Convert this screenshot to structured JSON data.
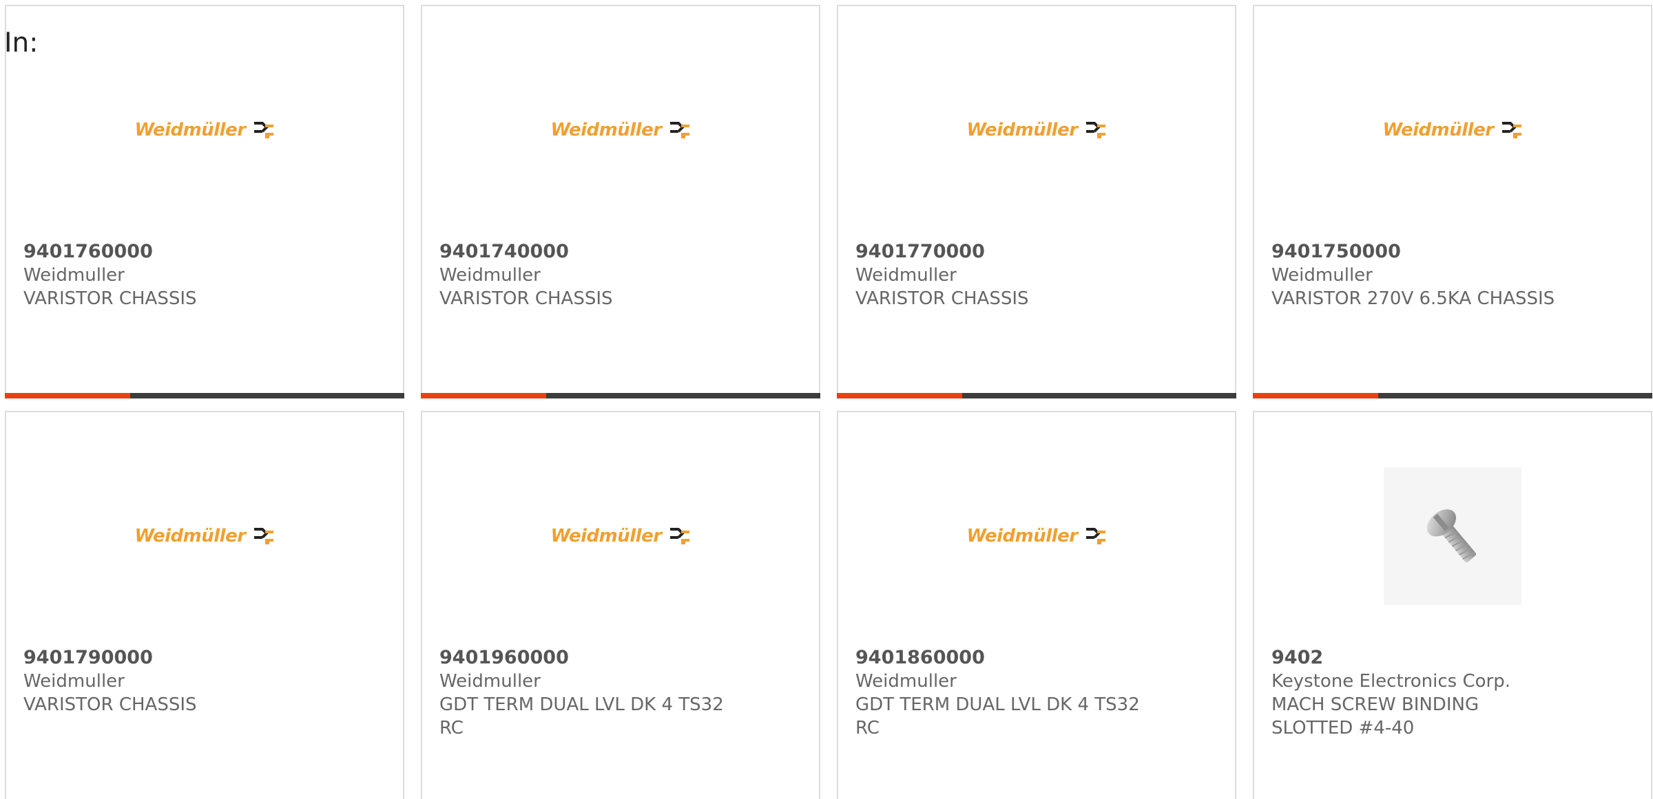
{
  "header": {
    "label": "In:"
  },
  "theme": {
    "accent_color": "#e8430e",
    "bar_color": "#3d3d3d",
    "logo_color": "#f0a030"
  },
  "products": [
    {
      "part_number": "9401760000",
      "manufacturer": "Weidmuller",
      "description": "VARISTOR CHASSIS",
      "image": "weidmuller-logo",
      "logo_text": "Weidmüller"
    },
    {
      "part_number": "9401740000",
      "manufacturer": "Weidmuller",
      "description": "VARISTOR CHASSIS",
      "image": "weidmuller-logo",
      "logo_text": "Weidmüller"
    },
    {
      "part_number": "9401770000",
      "manufacturer": "Weidmuller",
      "description": "VARISTOR CHASSIS",
      "image": "weidmuller-logo",
      "logo_text": "Weidmüller"
    },
    {
      "part_number": "9401750000",
      "manufacturer": "Weidmuller",
      "description": "VARISTOR 270V 6.5KA CHASSIS",
      "image": "weidmuller-logo",
      "logo_text": "Weidmüller"
    },
    {
      "part_number": "9401790000",
      "manufacturer": "Weidmuller",
      "description": "VARISTOR CHASSIS",
      "image": "weidmuller-logo",
      "logo_text": "Weidmüller"
    },
    {
      "part_number": "9401960000",
      "manufacturer": "Weidmuller",
      "description": "GDT TERM DUAL LVL DK 4 TS32 RC",
      "image": "weidmuller-logo",
      "logo_text": "Weidmüller"
    },
    {
      "part_number": "9401860000",
      "manufacturer": "Weidmuller",
      "description": "GDT TERM DUAL LVL DK 4 TS32 RC",
      "image": "weidmuller-logo",
      "logo_text": "Weidmüller"
    },
    {
      "part_number": "9402",
      "manufacturer": "Keystone Electronics Corp.",
      "description": "MACH SCREW BINDING SLOTTED #4-40",
      "image": "screw-photo",
      "logo_text": ""
    }
  ]
}
